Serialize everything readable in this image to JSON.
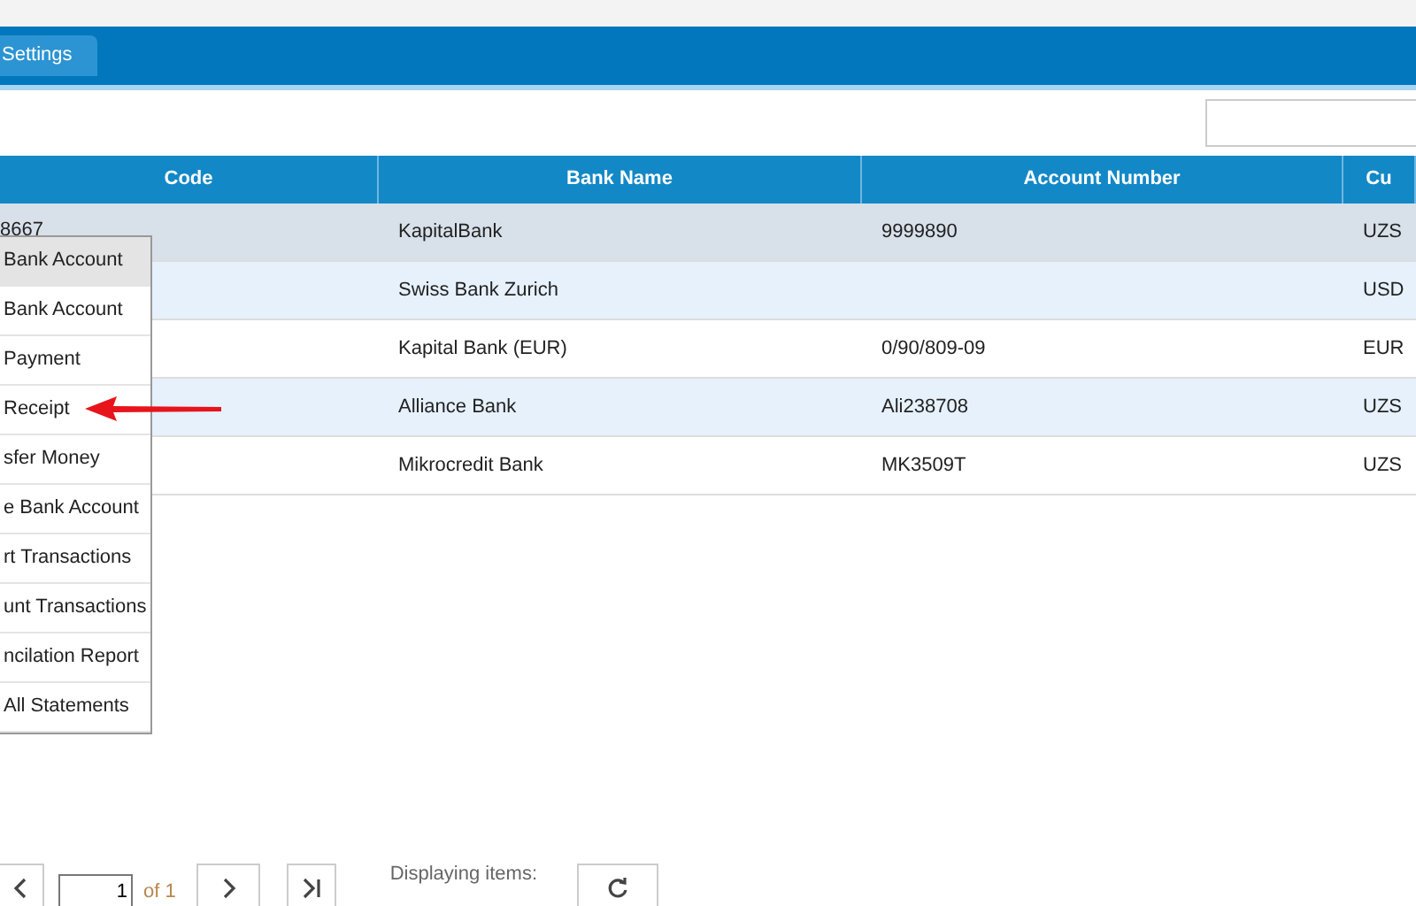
{
  "tabs": [
    {
      "label": "Settings",
      "selected": true
    }
  ],
  "table": {
    "columns": [
      "Code",
      "Bank Name",
      "Account Number",
      "Cu"
    ],
    "rows": [
      {
        "cells": [
          "8667",
          "KapitalBank",
          "9999890",
          "UZS"
        ],
        "selected": true
      },
      {
        "cells": [
          "",
          "Swiss Bank Zurich",
          "",
          "USD"
        ],
        "selected": false
      },
      {
        "cells": [
          "",
          "Kapital Bank (EUR)",
          "0/90/809-09",
          "EUR"
        ],
        "selected": false
      },
      {
        "cells": [
          "",
          "Alliance Bank",
          "Ali238708",
          "UZS"
        ],
        "selected": false
      },
      {
        "cells": [
          "",
          "Mikrocredit Bank",
          "MK3509T",
          "UZS"
        ],
        "selected": false
      }
    ]
  },
  "context_menu": {
    "items": [
      {
        "label": "Bank Account",
        "selected": true
      },
      {
        "label": "Bank Account",
        "selected": false
      },
      {
        "label": "Payment",
        "selected": false
      },
      {
        "label": "Receipt",
        "selected": false,
        "pointed": true
      },
      {
        "label": "sfer Money",
        "selected": false
      },
      {
        "label": "e Bank Account",
        "selected": false
      },
      {
        "label": "rt Transactions",
        "selected": false
      },
      {
        "label": "unt Transactions",
        "selected": false
      },
      {
        "label": "ncilation Report",
        "selected": false
      },
      {
        "label": "All Statements",
        "selected": false
      }
    ]
  },
  "pager": {
    "page": "1",
    "of_label": "of",
    "total": "1",
    "info": "Displaying items:"
  }
}
